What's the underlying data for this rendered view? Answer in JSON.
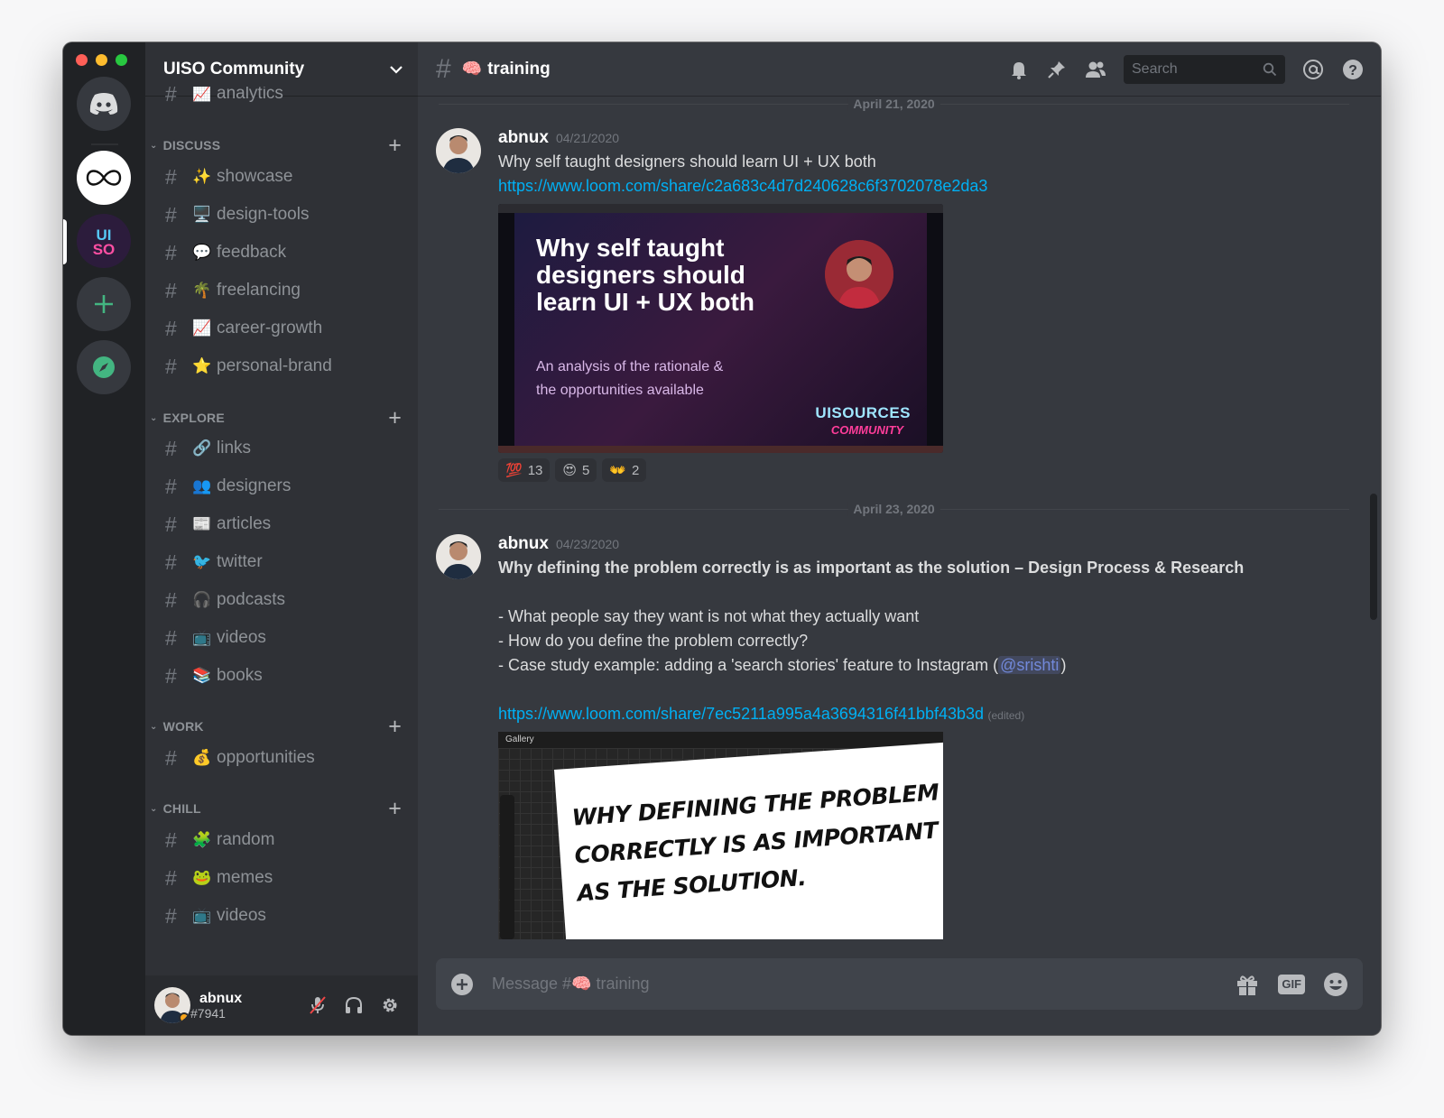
{
  "guild": {
    "name": "UISO Community"
  },
  "channels_partial": {
    "label": "analytics",
    "emoji": "📈"
  },
  "categories": [
    {
      "name": "DISCUSS",
      "channels": [
        {
          "emoji": "✨",
          "label": "showcase"
        },
        {
          "emoji": "🖥️",
          "label": "design-tools"
        },
        {
          "emoji": "💬",
          "label": "feedback"
        },
        {
          "emoji": "🌴",
          "label": "freelancing"
        },
        {
          "emoji": "📈",
          "label": "career-growth"
        },
        {
          "emoji": "⭐",
          "label": "personal-brand"
        }
      ]
    },
    {
      "name": "EXPLORE",
      "channels": [
        {
          "emoji": "🔗",
          "label": "links"
        },
        {
          "emoji": "👥",
          "label": "designers"
        },
        {
          "emoji": "📰",
          "label": "articles"
        },
        {
          "emoji": "🐦",
          "label": "twitter"
        },
        {
          "emoji": "🎧",
          "label": "podcasts"
        },
        {
          "emoji": "📺",
          "label": "videos"
        },
        {
          "emoji": "📚",
          "label": "books"
        }
      ]
    },
    {
      "name": "WORK",
      "channels": [
        {
          "emoji": "💰",
          "label": "opportunities"
        }
      ]
    },
    {
      "name": "CHILL",
      "channels": [
        {
          "emoji": "🧩",
          "label": "random"
        },
        {
          "emoji": "🐸",
          "label": "memes"
        },
        {
          "emoji": "📺",
          "label": "videos"
        }
      ]
    }
  ],
  "user": {
    "name": "abnux",
    "tag": "#7941"
  },
  "topbar": {
    "channel": "training",
    "channel_emoji": "🧠",
    "search_placeholder": "Search"
  },
  "messages": [
    {
      "date": "April 21, 2020",
      "author": "abnux",
      "timestamp": "04/21/2020",
      "text": "Why self taught designers should learn UI + UX both",
      "link": "https://www.loom.com/share/c2a683c4d7d240628c6f3702078e2da3",
      "embed": {
        "title": "Why self taught designers should learn UI + UX both",
        "subtitle_line1": "An analysis of the rationale &",
        "subtitle_line2": "the opportunities available",
        "brand1": "UISOURCES",
        "brand2": "COMMUNITY"
      },
      "reactions": [
        {
          "emoji": "💯",
          "count": "13"
        },
        {
          "emoji": "😍",
          "count": "5"
        },
        {
          "emoji": "👐",
          "count": "2"
        }
      ]
    },
    {
      "date": "April 23, 2020",
      "author": "abnux",
      "timestamp": "04/23/2020",
      "title": "Why defining the problem correctly is as important as the solution – Design Process & Research",
      "bullet1": "- What people say they want is not what they actually want",
      "bullet2": "- How do you define the problem correctly?",
      "bullet3_pre": "- Case study example: adding a 'search stories' feature to Instagram (",
      "mention": "@srishti",
      "bullet3_post": ")",
      "link": "https://www.loom.com/share/7ec5211a995a4a3694316f41bbf43b3d",
      "edited": "(edited)",
      "embed": {
        "gallery": "Gallery",
        "hand1": "WHY DEFINING THE PROBLEM",
        "hand2": "CORRECTLY IS AS IMPORTANT",
        "hand3": "AS THE SOLUTION."
      }
    }
  ],
  "composer": {
    "placeholder": "Message #🧠 training",
    "gif": "GIF"
  },
  "colors": {
    "accent": "#7289da",
    "link": "#00b0f4",
    "bg": "#36393f",
    "sidebar": "#2f3136",
    "rail": "#202225",
    "green": "#43b581"
  }
}
